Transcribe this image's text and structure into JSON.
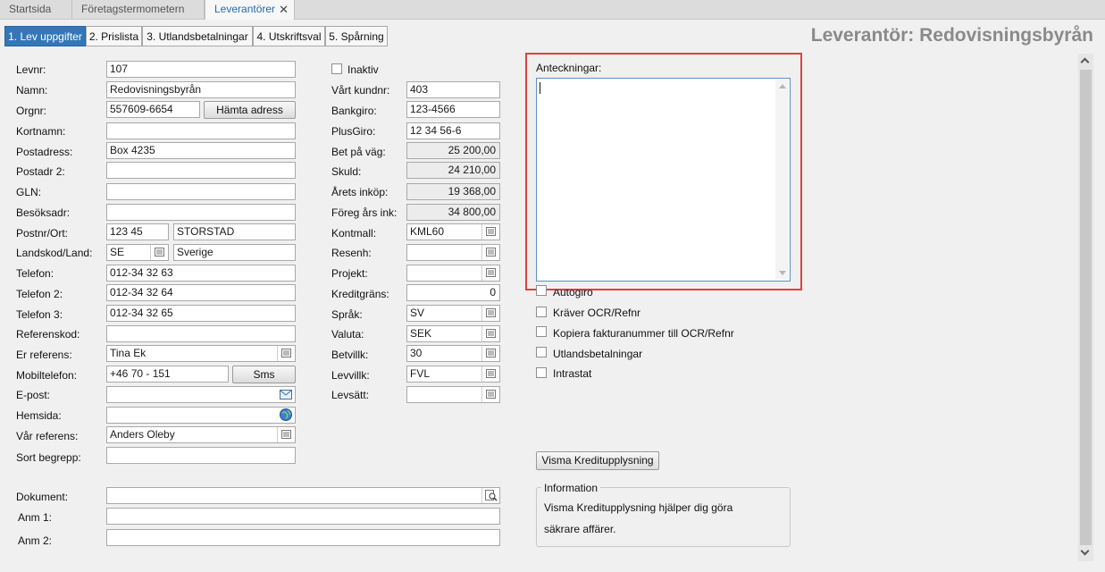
{
  "doc_tabs": [
    "Startsida",
    "Företagstermometern",
    "Leverantörer"
  ],
  "doc_tab_close": "✕",
  "sub_tabs": [
    "1. Lev uppgifter",
    "2. Prislista",
    "3. Utlandsbetalningar",
    "4. Utskriftsval",
    "5. Spårning"
  ],
  "page_title": "Leverantör: Redovisningsbyrån",
  "left": {
    "levnr": {
      "label": "Levnr:",
      "value": "107"
    },
    "namn": {
      "label": "Namn:",
      "value": "Redovisningsbyrån"
    },
    "orgnr": {
      "label": "Orgnr:",
      "value": "557609-6654",
      "button": "Hämta adress"
    },
    "kortnamn": {
      "label": "Kortnamn:",
      "value": ""
    },
    "postadress": {
      "label": "Postadress:",
      "value": "Box 4235"
    },
    "postadr2": {
      "label": "Postadr 2:",
      "value": ""
    },
    "gln": {
      "label": "GLN:",
      "value": ""
    },
    "besoksadr": {
      "label": "Besöksadr:",
      "value": ""
    },
    "postnr_ort": {
      "label": "Postnr/Ort:",
      "postnr": "123 45",
      "ort": "STORSTAD"
    },
    "landskod": {
      "label": "Landskod/Land:",
      "code": "SE",
      "land": "Sverige"
    },
    "telefon": {
      "label": "Telefon:",
      "value": "012-34 32 63"
    },
    "telefon2": {
      "label": "Telefon 2:",
      "value": "012-34 32 64"
    },
    "telefon3": {
      "label": "Telefon 3:",
      "value": "012-34 32 65"
    },
    "referenskod": {
      "label": "Referenskod:",
      "value": ""
    },
    "er_referens": {
      "label": "Er referens:",
      "value": "Tina Ek"
    },
    "mobiltelefon": {
      "label": "Mobiltelefon:",
      "value": "+46 70 - 151",
      "button": "Sms"
    },
    "epost": {
      "label": "E-post:",
      "value": ""
    },
    "hemsida": {
      "label": "Hemsida:",
      "value": ""
    },
    "var_referens": {
      "label": "Vår referens:",
      "value": "Anders Oleby"
    },
    "sort_begrepp": {
      "label": "Sort begrepp:",
      "value": ""
    },
    "dokument": {
      "label": "Dokument:",
      "value": ""
    },
    "anm1": {
      "label": "Anm 1:",
      "value": ""
    },
    "anm2": {
      "label": "Anm 2:",
      "value": ""
    }
  },
  "middle": {
    "inaktiv": "Inaktiv",
    "vart_kundnr": {
      "label": "Vårt kundnr:",
      "value": "403"
    },
    "bankgiro": {
      "label": "Bankgiro:",
      "value": "123-4566"
    },
    "plusgiro": {
      "label": "PlusGiro:",
      "value": "12 34 56-6"
    },
    "bet_pa_vag": {
      "label": "Bet på väg:",
      "value": "25 200,00"
    },
    "skuld": {
      "label": "Skuld:",
      "value": "24 210,00"
    },
    "arets_inkop": {
      "label": "Årets inköp:",
      "value": "19 368,00"
    },
    "foreg_ars_ink": {
      "label": "Föreg års ink:",
      "value": "34 800,00"
    },
    "kontmall": {
      "label": "Kontmall:",
      "value": "KML60"
    },
    "resenh": {
      "label": "Resenh:",
      "value": ""
    },
    "projekt": {
      "label": "Projekt:",
      "value": ""
    },
    "kreditgrans": {
      "label": "Kreditgräns:",
      "value": "0"
    },
    "sprak": {
      "label": "Språk:",
      "value": "SV"
    },
    "valuta": {
      "label": "Valuta:",
      "value": "SEK"
    },
    "betvillk": {
      "label": "Betvillk:",
      "value": "30"
    },
    "levvillk": {
      "label": "Levvillk:",
      "value": "FVL"
    },
    "levsatt": {
      "label": "Levsätt:",
      "value": ""
    }
  },
  "right": {
    "notes_label": "Anteckningar:",
    "notes_value": "",
    "checkboxes": [
      "Autogiro",
      "Kräver OCR/Refnr",
      "Kopiera fakturanummer till OCR/Refnr",
      "Utlandsbetalningar",
      "Intrastat"
    ],
    "kredit_button": "Visma Kreditupplysning",
    "info_title": "Information",
    "info_line1": "Visma Kreditupplysning hjälper dig göra",
    "info_line2": "säkrare affärer."
  },
  "icons": {
    "lookup": "list-lookup-icon",
    "email": "envelope-icon",
    "web": "globe-icon",
    "document": "magnifier-icon"
  },
  "colors": {
    "active_tab": "#3477b8",
    "highlight": "#e04040",
    "title": "#8a8a8a"
  }
}
